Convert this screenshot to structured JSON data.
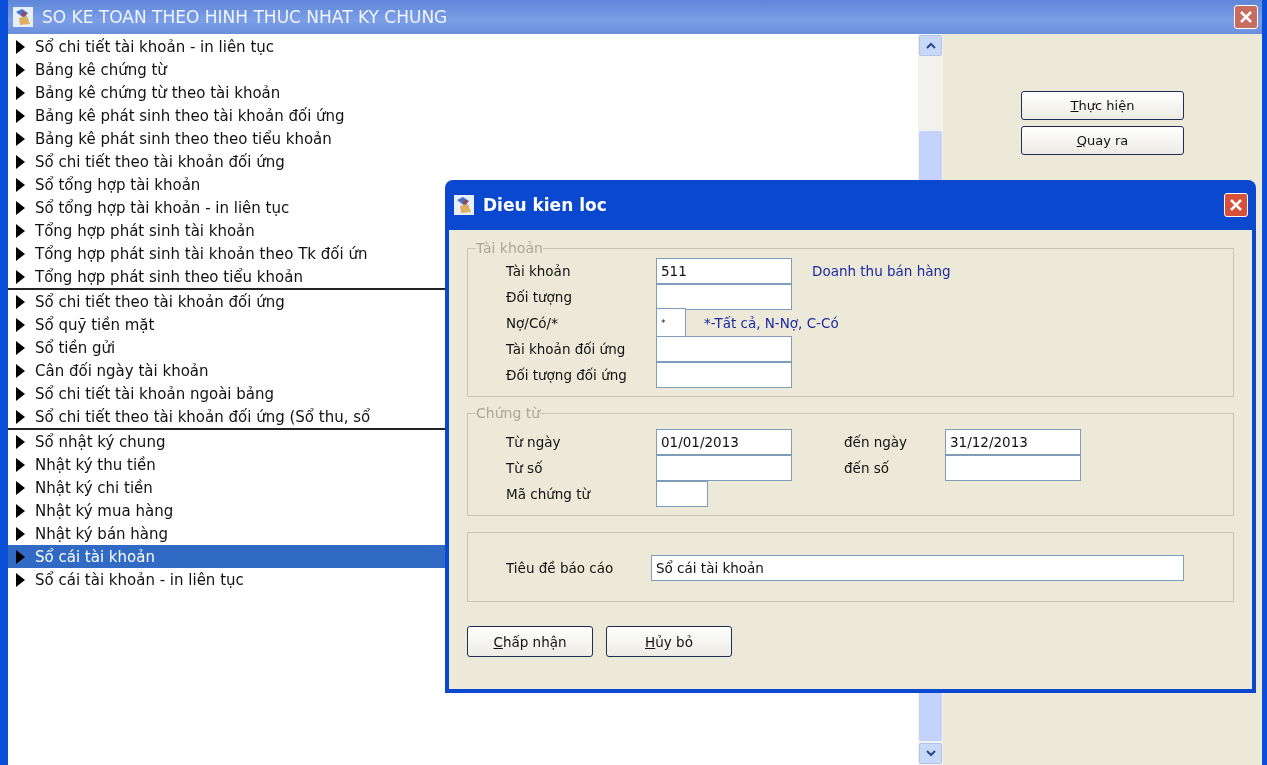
{
  "window": {
    "title": "SO KE TOAN THEO HINH THUC NHAT KY CHUNG"
  },
  "report_list": {
    "groups": [
      {
        "items": [
          {
            "label": "Sổ chi tiết tài khoản - in liên tục",
            "selected": false
          },
          {
            "label": "Bảng kê chứng từ",
            "selected": false
          },
          {
            "label": "Bảng kê chứng từ theo tài khoản",
            "selected": false
          },
          {
            "label": "Bảng kê phát sinh theo tài khoản đối ứng",
            "selected": false
          },
          {
            "label": "Bảng kê phát sinh theo theo tiểu khoản",
            "selected": false
          },
          {
            "label": "Sổ chi tiết theo tài khoản đối ứng",
            "selected": false
          },
          {
            "label": "Sổ tổng hợp tài khoản",
            "selected": false
          },
          {
            "label": "Sổ tổng hợp tài khoản - in liên tục",
            "selected": false
          },
          {
            "label": "Tổng hợp phát sinh tài khoản",
            "selected": false
          },
          {
            "label": "Tổng hợp phát sinh tài khoản theo Tk đối ứn",
            "selected": false
          },
          {
            "label": "Tổng hợp phát sinh theo tiểu khoản",
            "selected": false
          }
        ]
      },
      {
        "items": [
          {
            "label": "Sổ chi tiết theo tài khoản đối ứng",
            "selected": false
          },
          {
            "label": "Sổ quỹ tiền mặt",
            "selected": false
          },
          {
            "label": "Sổ tiền gửi",
            "selected": false
          },
          {
            "label": "Cân đối ngày tài khoản",
            "selected": false
          },
          {
            "label": "Sổ chi tiết tài khoản ngoài bảng",
            "selected": false
          },
          {
            "label": "Sổ chi tiết theo tài khoản đối ứng (Sổ thu, sổ",
            "selected": false
          }
        ]
      },
      {
        "items": [
          {
            "label": "Sổ nhật ký chung",
            "selected": false
          },
          {
            "label": "Nhật ký thu tiền",
            "selected": false
          },
          {
            "label": "Nhật ký chi tiền",
            "selected": false
          },
          {
            "label": "Nhật ký mua hàng",
            "selected": false
          },
          {
            "label": "Nhật ký bán hàng",
            "selected": false
          },
          {
            "label": "Sổ cái tài khoản",
            "selected": true
          },
          {
            "label": "Sổ cái tài khoản - in liên tục",
            "selected": false
          }
        ]
      }
    ]
  },
  "actions": [
    "Thực hiện",
    "Quay ra"
  ],
  "dialog": {
    "title": "Dieu kien loc",
    "account_group": {
      "legend": "Tài khoản",
      "rows": [
        {
          "label": "Tài khoản",
          "value": "511",
          "kind": "wide",
          "hint": "Doanh thu bán hàng"
        },
        {
          "label": "Đối tượng",
          "kind": "wide"
        },
        {
          "label": "Nợ/Có/*",
          "value": "*",
          "kind": "tiny",
          "hint": "*-Tất cả, N-Nợ, C-Có"
        },
        {
          "label": "Tài khoản đối ứng",
          "kind": "wide"
        },
        {
          "label": "Đối tượng đối ứng",
          "kind": "wide"
        }
      ]
    },
    "voucher_group": {
      "legend": "Chứng từ",
      "rows": [
        {
          "label": "Từ ngày",
          "value": "01/01/2013",
          "to_label": "đến ngày",
          "to_value": "31/12/2013"
        },
        {
          "label": "Từ số",
          "to_label": "đến số"
        },
        {
          "label": "Mã chứng từ",
          "kind": "small"
        }
      ]
    },
    "report_title": {
      "label": "Tiêu đề báo cáo",
      "value": "Sổ cái tài khoản"
    },
    "buttons": [
      "Chấp nhận",
      "Hủy bỏ"
    ]
  }
}
